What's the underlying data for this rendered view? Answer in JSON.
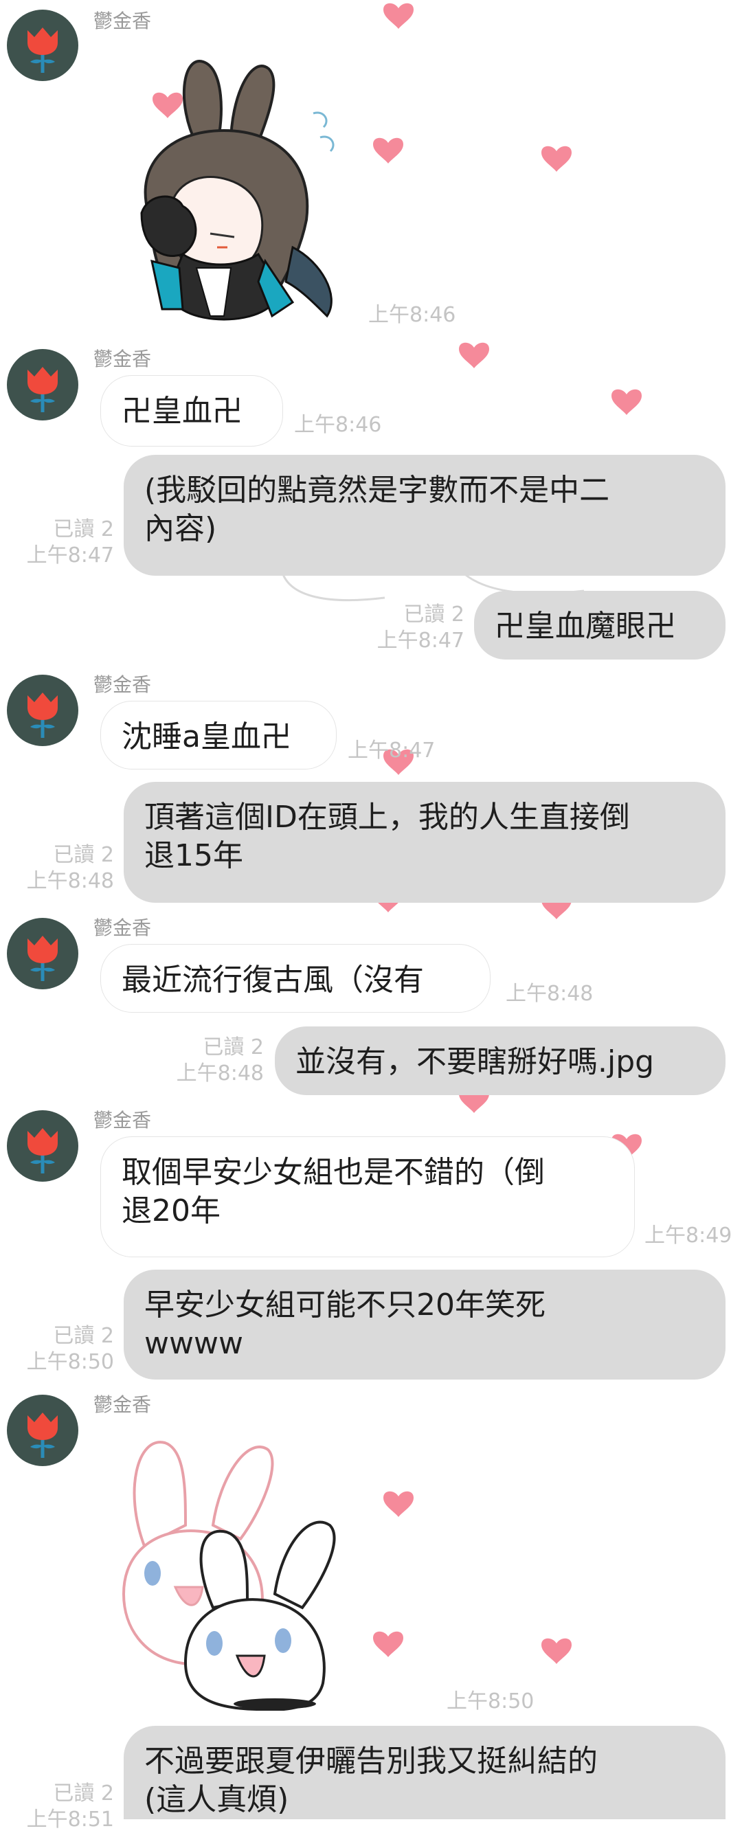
{
  "chat": {
    "sender_name": "鬱金香",
    "read_label": "已讀 2",
    "msg1": {
      "time": "上午8:46",
      "type": "sticker",
      "sticker": "bunny-ear-girl-facepalm-sticker"
    },
    "msg2": {
      "text": "卍皇血卍",
      "time": "上午8:46"
    },
    "msg3": {
      "text": "(我駁回的點竟然是字數而不是中二\n內容)",
      "time": "上午8:47",
      "read": "已讀 2"
    },
    "msg4": {
      "text": "卍皇血魔眼卍",
      "time": "上午8:47",
      "read": "已讀 2"
    },
    "msg5": {
      "text": "沈睡a皇血卍",
      "time": "上午8:47"
    },
    "msg6": {
      "text": "頂著這個ID在頭上，我的人生直接倒\n退15年",
      "time": "上午8:48",
      "read": "已讀 2"
    },
    "msg7": {
      "text": "最近流行復古風（沒有",
      "time": "上午8:48"
    },
    "msg8": {
      "text": "並沒有，不要瞎掰好嗎.jpg",
      "time": "上午8:48",
      "read": "已讀 2"
    },
    "msg9": {
      "text": "取個早安少女組也是不錯的（倒\n退20年",
      "time": "上午8:49"
    },
    "msg10": {
      "text": "早安少女組可能不只20年笑死\nwwww",
      "time": "上午8:50",
      "read": "已讀 2"
    },
    "msg11": {
      "time": "上午8:50",
      "type": "sticker",
      "sticker": "two-white-bunnies-sticker"
    },
    "msg12": {
      "text": "不過要跟夏伊曬告別我又挺糾結的\n(這人真煩)",
      "time": "上午8:51",
      "read": "已讀 2"
    }
  },
  "colors": {
    "heart": "#f58a9a",
    "out_bubble": "#dadada",
    "in_bubble": "#ffffff",
    "avatar_bg": "#3e524d",
    "avatar_flower": "#f04a3c",
    "avatar_stem": "#2a8cb8"
  }
}
